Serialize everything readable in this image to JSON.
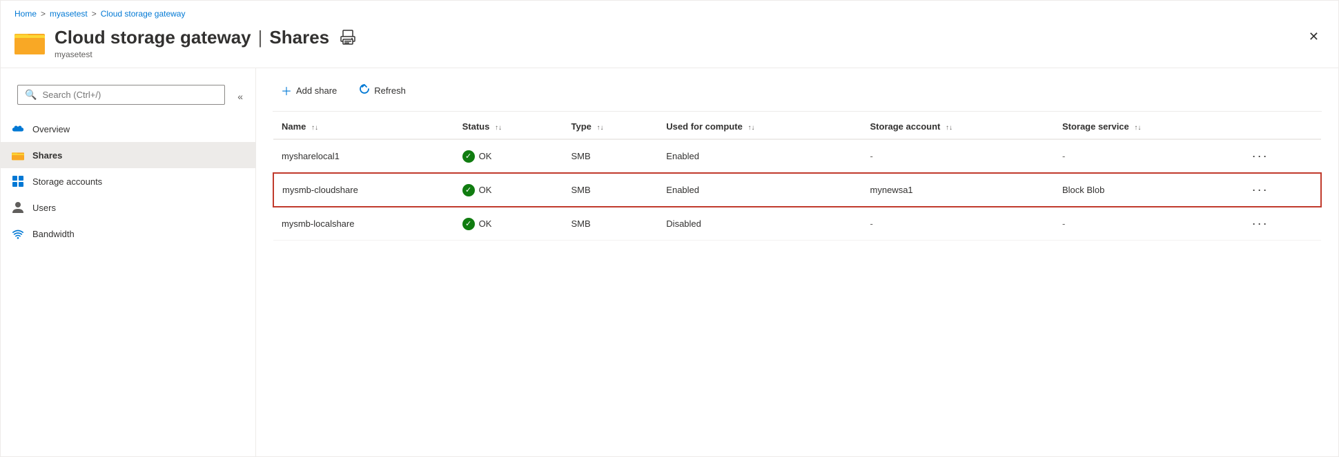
{
  "breadcrumb": {
    "items": [
      "Home",
      "myasetest",
      "Cloud storage gateway"
    ],
    "separators": [
      ">",
      ">"
    ]
  },
  "header": {
    "title": "Cloud storage gateway",
    "separator": "|",
    "section": "Shares",
    "subtitle": "myasetest",
    "print_label": "print",
    "close_label": "close"
  },
  "sidebar": {
    "search_placeholder": "Search (Ctrl+/)",
    "collapse_label": "«",
    "nav_items": [
      {
        "id": "overview",
        "label": "Overview",
        "icon": "cloud",
        "active": false
      },
      {
        "id": "shares",
        "label": "Shares",
        "icon": "folder",
        "active": true
      },
      {
        "id": "storage-accounts",
        "label": "Storage accounts",
        "icon": "grid",
        "active": false
      },
      {
        "id": "users",
        "label": "Users",
        "icon": "person",
        "active": false
      },
      {
        "id": "bandwidth",
        "label": "Bandwidth",
        "icon": "wifi",
        "active": false
      }
    ]
  },
  "toolbar": {
    "add_share_label": "Add share",
    "refresh_label": "Refresh"
  },
  "table": {
    "columns": [
      {
        "id": "name",
        "label": "Name"
      },
      {
        "id": "status",
        "label": "Status"
      },
      {
        "id": "type",
        "label": "Type"
      },
      {
        "id": "used_for_compute",
        "label": "Used for compute"
      },
      {
        "id": "storage_account",
        "label": "Storage account"
      },
      {
        "id": "storage_service",
        "label": "Storage service"
      },
      {
        "id": "actions",
        "label": ""
      }
    ],
    "rows": [
      {
        "name": "mysharelocal1",
        "status_icon": "✓",
        "status_text": "OK",
        "type": "SMB",
        "used_for_compute": "Enabled",
        "storage_account": "-",
        "storage_service": "-",
        "highlighted": false
      },
      {
        "name": "mysmb-cloudshare",
        "status_icon": "✓",
        "status_text": "OK",
        "type": "SMB",
        "used_for_compute": "Enabled",
        "storage_account": "mynewsa1",
        "storage_service": "Block Blob",
        "highlighted": true
      },
      {
        "name": "mysmb-localshare",
        "status_icon": "✓",
        "status_text": "OK",
        "type": "SMB",
        "used_for_compute": "Disabled",
        "storage_account": "-",
        "storage_service": "-",
        "highlighted": false
      }
    ]
  }
}
